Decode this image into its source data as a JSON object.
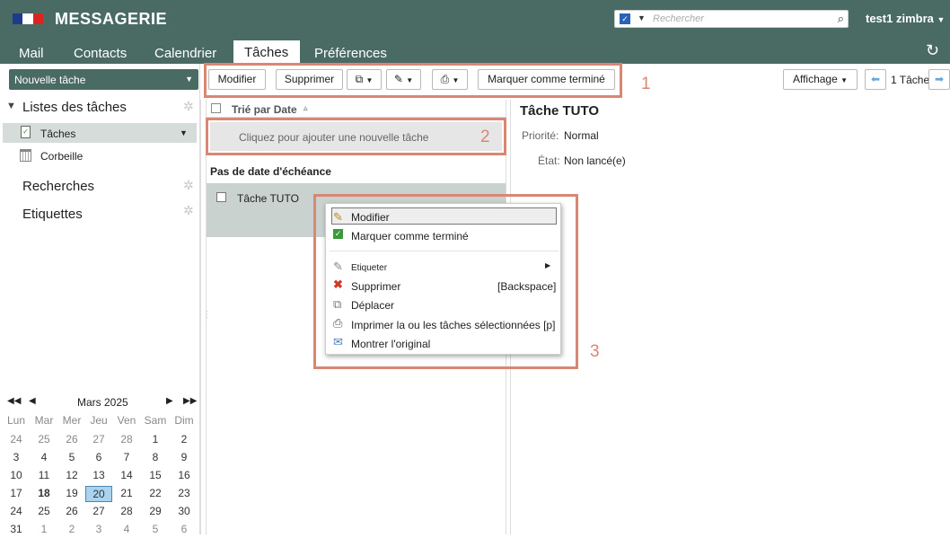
{
  "header": {
    "brand": "MESSAGERIE",
    "search_placeholder": "Rechercher",
    "user": "test1 zimbra"
  },
  "tabs": [
    "Mail",
    "Contacts",
    "Calendrier",
    "Tâches",
    "Préférences"
  ],
  "sidebar": {
    "new_task": "Nouvelle tâche",
    "task_lists_header": "Listes des tâches",
    "items": [
      "Tâches",
      "Corbeille"
    ],
    "searches": "Recherches",
    "tags": "Etiquettes"
  },
  "toolbar": {
    "edit": "Modifier",
    "delete": "Supprimer",
    "mark_done": "Marquer comme terminé",
    "view": "Affichage",
    "count": "1 Tâche"
  },
  "annotations": [
    "1",
    "2",
    "3"
  ],
  "list": {
    "sort_label": "Trié par Date",
    "add_prompt": "Cliquez pour ajouter une nouvelle tâche",
    "group": "Pas de date d'échéance",
    "task": "Tâche TUTO"
  },
  "detail": {
    "title": "Tâche TUTO",
    "priority_label": "Priorité:",
    "priority_value": "Normal",
    "state_label": "État:",
    "state_value": "Non lancé(e)"
  },
  "context_menu": {
    "edit": "Modifier",
    "mark_done": "Marquer comme terminé",
    "tag": "Etiqueter",
    "delete": "Supprimer",
    "delete_shortcut": "[Backspace]",
    "move": "Déplacer",
    "print": "Imprimer la ou les tâches sélectionnées [p]",
    "show_original": "Montrer l'original"
  },
  "calendar": {
    "month": "Mars 2025",
    "weekdays": [
      "Lun",
      "Mar",
      "Mer",
      "Jeu",
      "Ven",
      "Sam",
      "Dim"
    ],
    "weeks": [
      [
        "24",
        "25",
        "26",
        "27",
        "28",
        "1",
        "2"
      ],
      [
        "3",
        "4",
        "5",
        "6",
        "7",
        "8",
        "9"
      ],
      [
        "10",
        "11",
        "12",
        "13",
        "14",
        "15",
        "16"
      ],
      [
        "17",
        "18",
        "19",
        "20",
        "21",
        "22",
        "23"
      ],
      [
        "24",
        "25",
        "26",
        "27",
        "28",
        "29",
        "30"
      ],
      [
        "31",
        "1",
        "2",
        "3",
        "4",
        "5",
        "6"
      ]
    ],
    "today": "18",
    "selected": "20"
  },
  "colors": {
    "header_bg": "#4a6b63",
    "highlight": "#d98775"
  }
}
